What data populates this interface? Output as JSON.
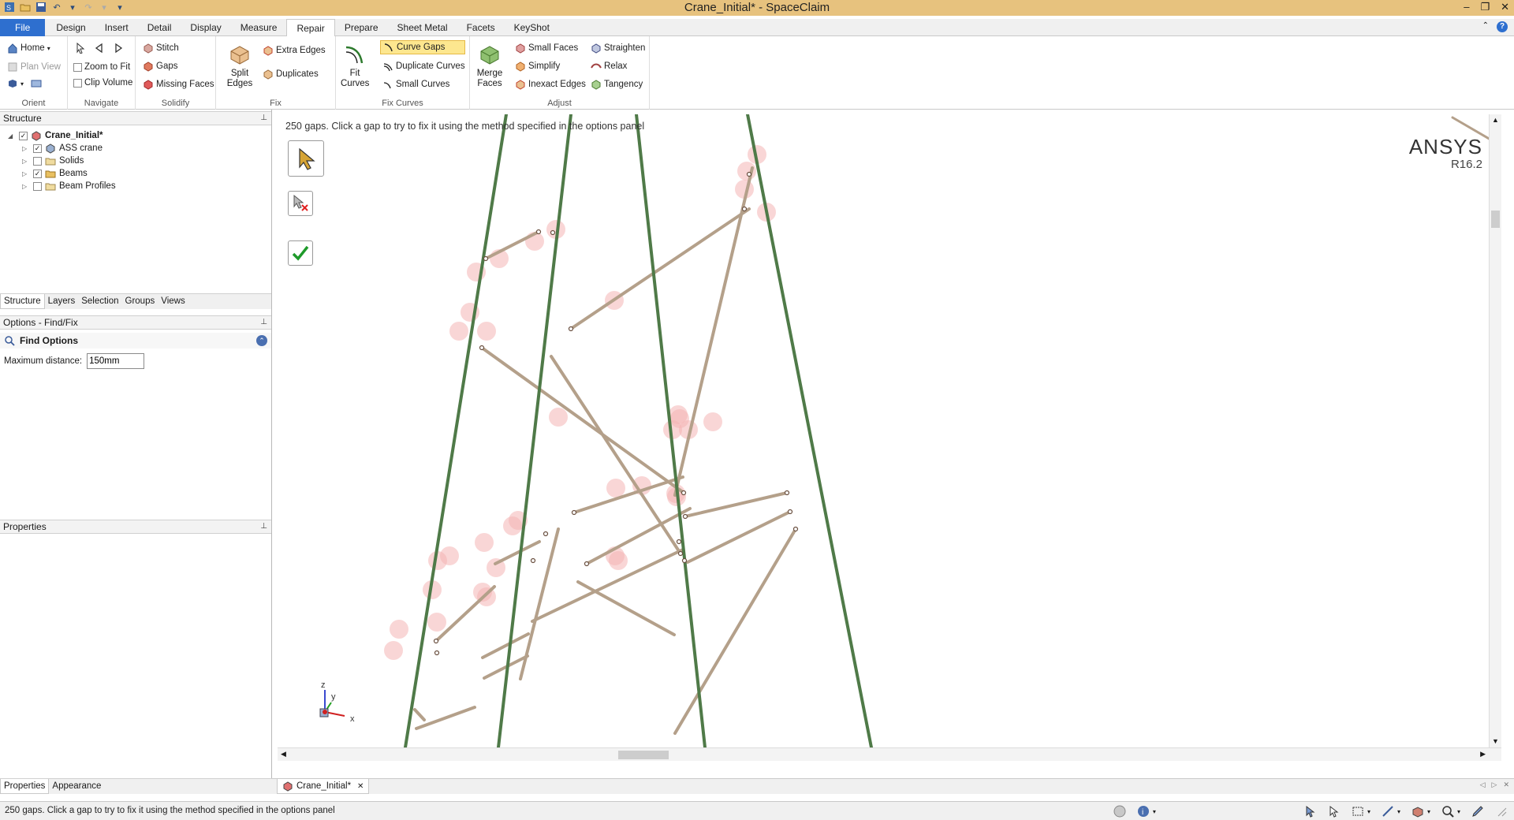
{
  "window": {
    "title": "Crane_Initial* - SpaceClaim"
  },
  "menu": {
    "tabs": [
      "File",
      "Design",
      "Insert",
      "Detail",
      "Display",
      "Measure",
      "Repair",
      "Prepare",
      "Sheet Metal",
      "Facets",
      "KeyShot"
    ],
    "active": "Repair"
  },
  "ribbon": {
    "orient": {
      "label": "Orient",
      "home": "Home",
      "plan_view": "Plan View"
    },
    "navigate": {
      "label": "Navigate",
      "zoom_to_fit": "Zoom to Fit",
      "clip_volume": "Clip Volume"
    },
    "solidify": {
      "label": "Solidify",
      "stitch": "Stitch",
      "gaps": "Gaps",
      "missing_faces": "Missing Faces"
    },
    "fix": {
      "label": "Fix",
      "split_edges": "Split Edges",
      "extra_edges": "Extra Edges",
      "duplicates": "Duplicates"
    },
    "fix_curves": {
      "label": "Fix Curves",
      "fit_curves": "Fit Curves",
      "curve_gaps": "Curve Gaps",
      "duplicate_curves": "Duplicate Curves",
      "small_curves": "Small Curves"
    },
    "adjust": {
      "label": "Adjust",
      "merge_faces": "Merge Faces",
      "small_faces": "Small Faces",
      "simplify": "Simplify",
      "inexact_edges": "Inexact Edges",
      "straighten": "Straighten",
      "relax": "Relax",
      "tangency": "Tangency"
    }
  },
  "structure": {
    "title": "Structure",
    "tree": [
      {
        "label": "Crane_Initial*",
        "level": 0,
        "checked": true
      },
      {
        "label": "ASS crane",
        "level": 1,
        "checked": true
      },
      {
        "label": "Solids",
        "level": 1,
        "checked": false
      },
      {
        "label": "Beams",
        "level": 1,
        "checked": true
      },
      {
        "label": "Beam Profiles",
        "level": 1,
        "checked": false
      }
    ],
    "tabs": [
      "Structure",
      "Layers",
      "Selection",
      "Groups",
      "Views"
    ]
  },
  "options": {
    "title": "Options - Find/Fix",
    "section": "Find Options",
    "max_distance_label": "Maximum distance:",
    "max_distance_value": "150mm"
  },
  "properties": {
    "title": "Properties",
    "tabs": [
      "Properties",
      "Appearance"
    ]
  },
  "viewport": {
    "status": "250 gaps. Click a gap to try to fix it using the method specified in the options panel",
    "brand": "ANSYS",
    "version": "R16.2",
    "axes": {
      "x": "x",
      "y": "y",
      "z": "z"
    },
    "colors": {
      "column": "#4f7a48",
      "brace": "#b4a08a",
      "gap": "#f4b4b4"
    }
  },
  "document_tab": "Crane_Initial*",
  "statusbar": {
    "message": "250 gaps. Click a gap to try to fix it using the method specified in the options panel"
  }
}
